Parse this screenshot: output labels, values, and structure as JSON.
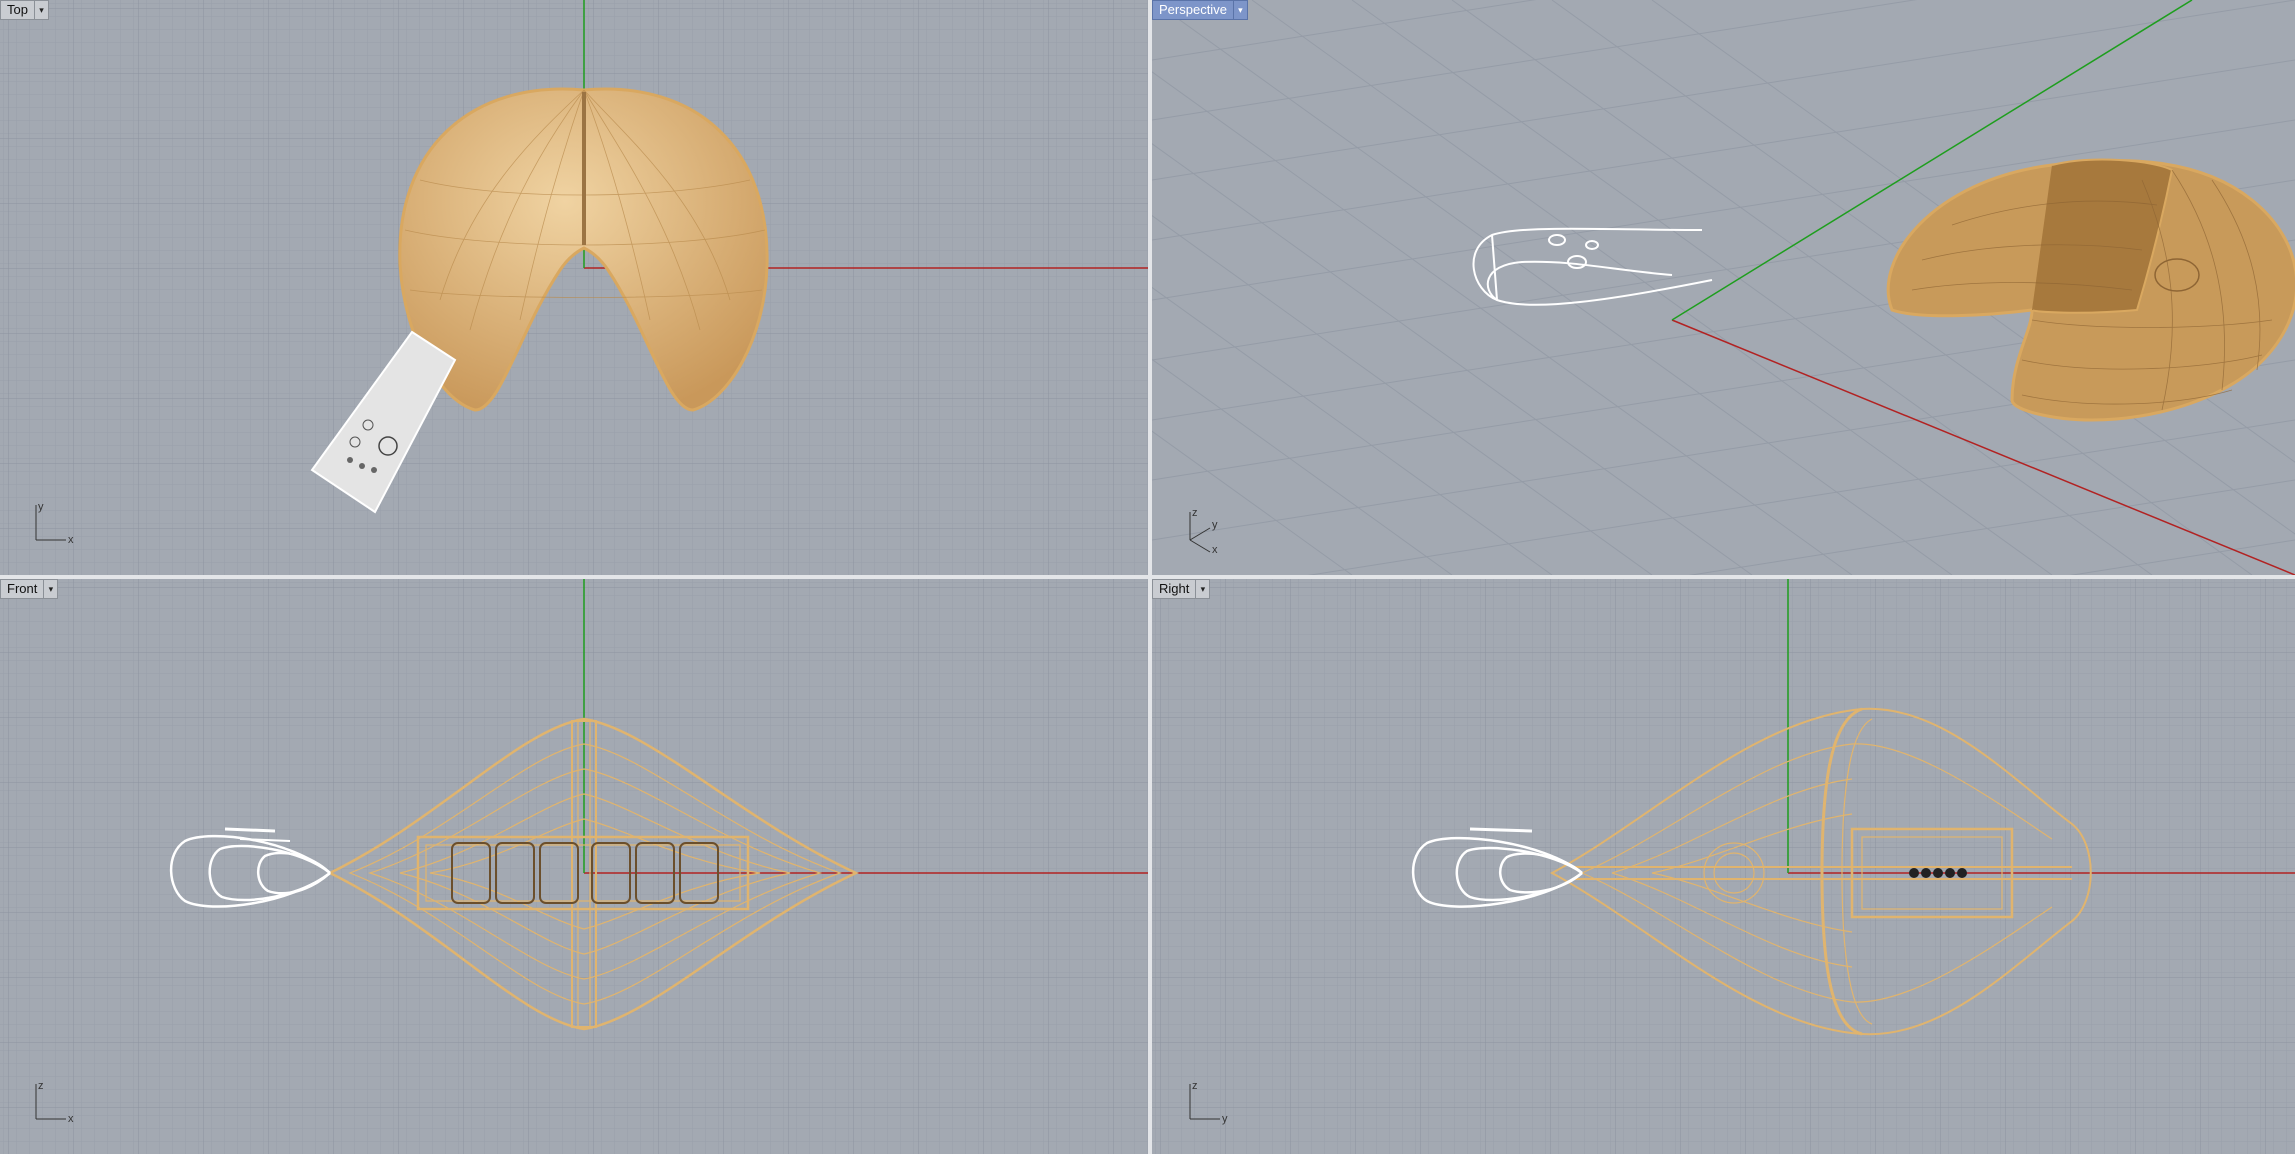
{
  "viewports": {
    "top": {
      "title": "Top",
      "axes": {
        "a": "y",
        "b": "x"
      }
    },
    "perspective": {
      "title": "Perspective",
      "axes": {
        "a": "z",
        "b": "y",
        "c": "x"
      }
    },
    "front": {
      "title": "Front",
      "axes": {
        "a": "z",
        "b": "x"
      }
    },
    "right": {
      "title": "Right",
      "axes": {
        "a": "z",
        "b": "y"
      }
    }
  },
  "icons": {
    "dropdown": "chevron-down-icon"
  },
  "colors": {
    "background": "#a3a9b2",
    "grid_minor": "#98a0ab",
    "grid_major": "#8c94a0",
    "x_axis": "#b22222",
    "y_axis": "#1e9e1e",
    "model_wire": "#d9a860",
    "model_fill": "#caa36a",
    "highlight_wire": "#ffffff",
    "active_tab": "#7d95c9"
  }
}
